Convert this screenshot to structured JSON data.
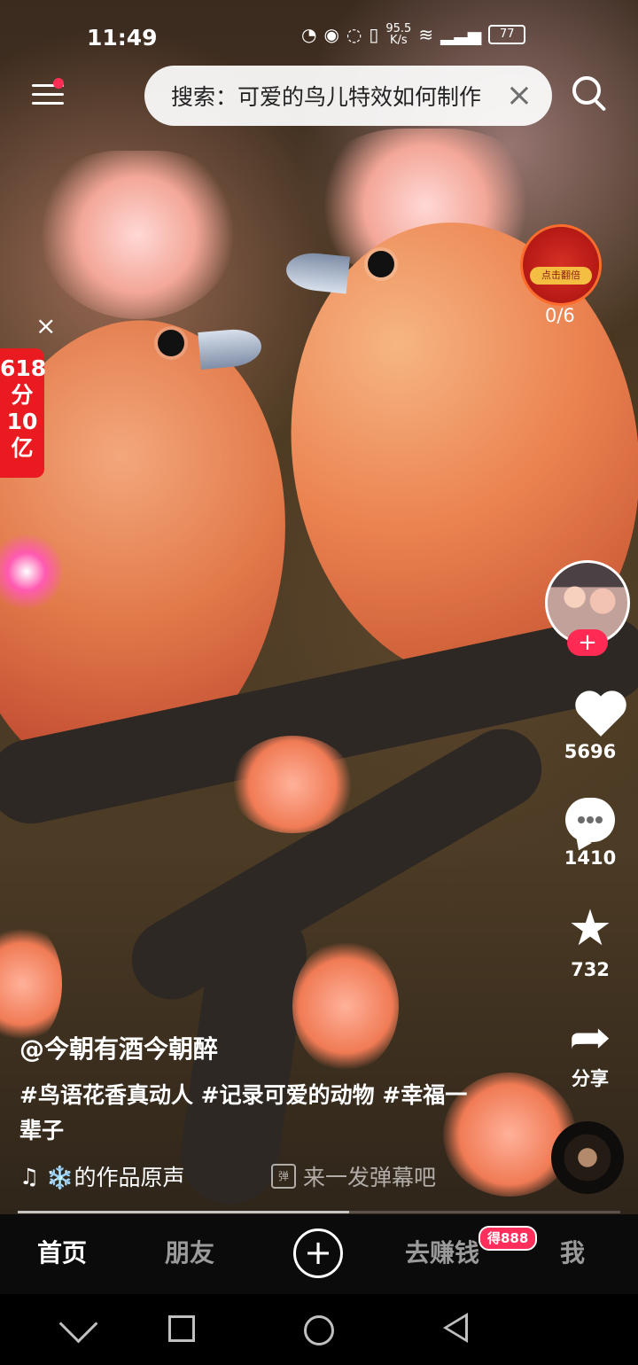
{
  "status_bar": {
    "time": "11:49",
    "network_speed": "95.5",
    "network_unit": "K/s",
    "battery": "77",
    "icons": [
      "phone-hd-icon",
      "eye-icon",
      "alarm-icon",
      "vibration-icon",
      "signal-icon",
      "wifi-icon",
      "battery-icon"
    ]
  },
  "search": {
    "text": "搜索：可爱的鸟儿特效如何制作",
    "close": "×"
  },
  "reward": {
    "label": "点击翻倍",
    "progress_text": "0/6"
  },
  "promo": {
    "close": "×",
    "line1": "618",
    "line2": "分",
    "line3": "10",
    "line4": "亿"
  },
  "actions": {
    "follow": "+",
    "like_count": "5696",
    "comment_count": "1410",
    "favorite_count": "732",
    "share_label": "分享"
  },
  "post": {
    "author": "@今朝有酒今朝醉",
    "caption": "#鸟语花香真动人 #记录可爱的动物 #幸福一辈子",
    "music": "❄️的作品原声",
    "danmaku": "来一发弹幕吧"
  },
  "bottom_nav": {
    "home": "首页",
    "friends": "朋友",
    "create": "+",
    "earn": "去赚钱",
    "earn_badge": "得888",
    "me": "我"
  },
  "playback": {
    "progress": 0.55
  },
  "colors": {
    "accent": "#ff2b55",
    "promo_red": "#ea1b20",
    "nav_bg": "#0b0b0b"
  }
}
